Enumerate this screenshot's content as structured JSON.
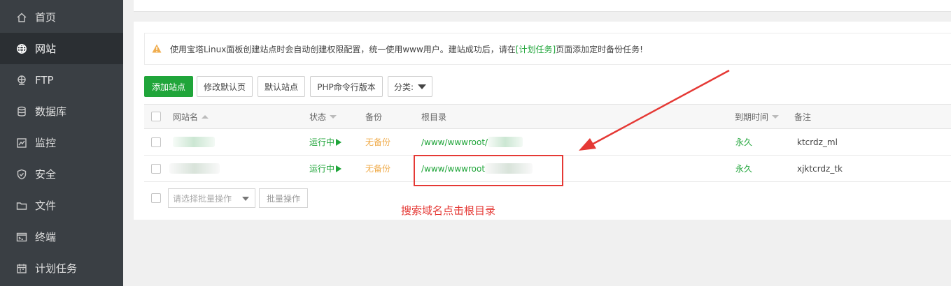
{
  "sidebar": {
    "items": [
      {
        "label": "首页",
        "icon": "home-icon"
      },
      {
        "label": "网站",
        "icon": "globe-icon",
        "active": true
      },
      {
        "label": "FTP",
        "icon": "ftp-icon"
      },
      {
        "label": "数据库",
        "icon": "database-icon"
      },
      {
        "label": "监控",
        "icon": "monitor-icon"
      },
      {
        "label": "安全",
        "icon": "shield-icon"
      },
      {
        "label": "文件",
        "icon": "folder-icon"
      },
      {
        "label": "终端",
        "icon": "terminal-icon"
      },
      {
        "label": "计划任务",
        "icon": "calendar-icon"
      }
    ]
  },
  "notice": {
    "text_before": "使用宝塔Linux面板创建站点时会自动创建权限配置，统一使用www用户。建站成功后，请在",
    "link": "[计划任务]",
    "text_after": "页面添加定时备份任务!"
  },
  "toolbar": {
    "add_site": "添加站点",
    "edit_default_page": "修改默认页",
    "default_site": "默认站点",
    "php_cli_version": "PHP命令行版本",
    "category": "分类:"
  },
  "table": {
    "headers": {
      "site_name": "网站名",
      "status": "状态",
      "backup": "备份",
      "root": "根目录",
      "expire": "到期时间",
      "remark": "备注"
    },
    "rows": [
      {
        "status": "运行中",
        "backup": "无备份",
        "root": "/www/wwwroot/",
        "expire": "永久",
        "remark": "ktcrdz_ml"
      },
      {
        "status": "运行中",
        "backup": "无备份",
        "root": "/www/wwwroot",
        "expire": "永久",
        "remark": "xjktcrdz_tk"
      }
    ]
  },
  "batch": {
    "select_placeholder": "请选择批量操作",
    "button": "批量操作"
  },
  "annotation": {
    "text": "搜索域名点击根目录",
    "color": "#e53935"
  },
  "colors": {
    "accent": "#20a53a",
    "warning": "#f0ad4e",
    "sidebar": "#3a3f44"
  }
}
